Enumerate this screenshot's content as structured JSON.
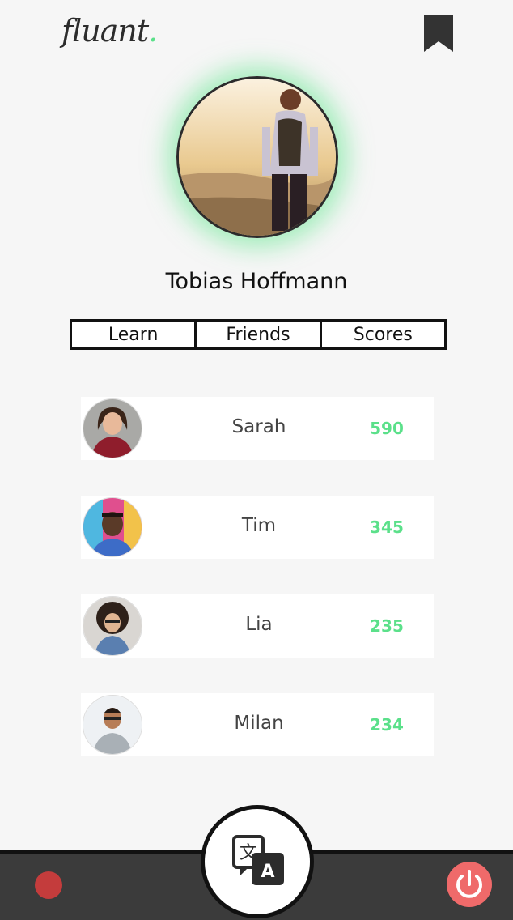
{
  "header": {
    "logo_text": "fluant",
    "logo_dot": ".",
    "bookmark_icon": "bookmark-icon"
  },
  "profile": {
    "name": "Tobias Hoffmann"
  },
  "tabs": [
    {
      "label": "Learn"
    },
    {
      "label": "Friends"
    },
    {
      "label": "Scores"
    }
  ],
  "scores": [
    {
      "name": "Sarah",
      "score": "590"
    },
    {
      "name": "Tim",
      "score": "345"
    },
    {
      "name": "Lia",
      "score": "235"
    },
    {
      "name": "Milan",
      "score": "234"
    }
  ],
  "bottom_bar": {
    "left_icon": "record-dot-icon",
    "center_icon": "translate-icon",
    "right_icon": "power-icon"
  },
  "colors": {
    "accent": "#5be08a",
    "dark": "#3b3b3b",
    "danger": "#ef6a6a"
  }
}
